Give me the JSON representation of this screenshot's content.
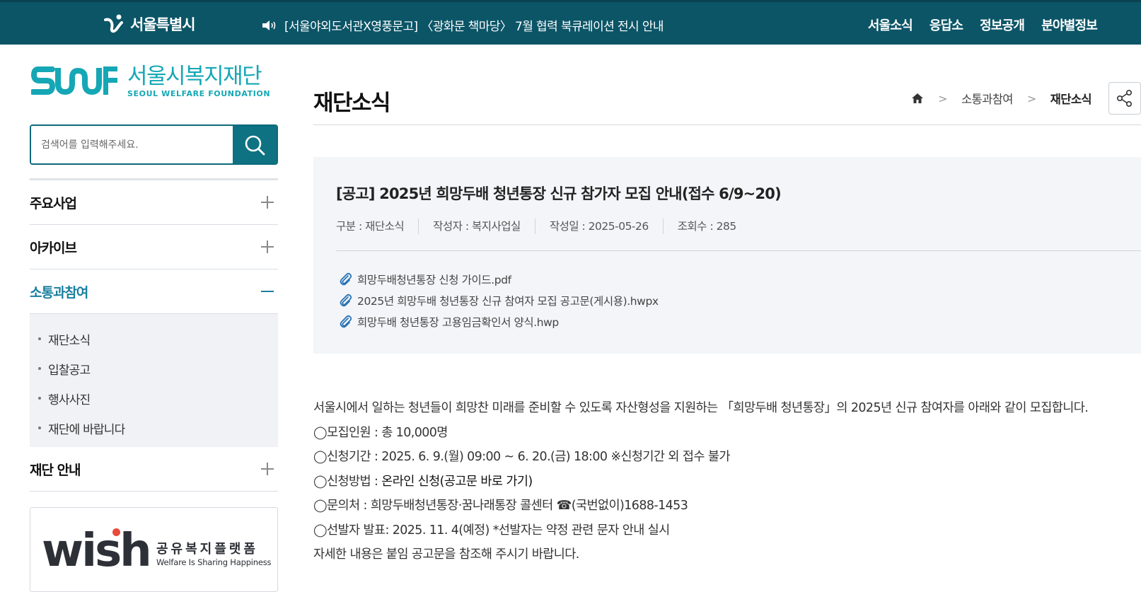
{
  "topbar": {
    "seoul_logo_text": "서울특별시",
    "notice_text": "[서울야외도서관X영풍문고] 〈광화문 책마당〉 7월 협력 북큐레이션 전시 안내",
    "nav": [
      "서울소식",
      "응답소",
      "정보공개",
      "분야별정보"
    ]
  },
  "brand": {
    "name_ko": "서울시복지재단",
    "name_en": "SEOUL WELFARE FOUNDATION"
  },
  "search": {
    "placeholder": "검색어를 입력해주세요."
  },
  "lnb": {
    "items": [
      {
        "label": "주요사업",
        "state": "collapsed"
      },
      {
        "label": "아카이브",
        "state": "collapsed"
      },
      {
        "label": "소통과참여",
        "state": "expanded"
      },
      {
        "label": "재단 안내",
        "state": "collapsed"
      }
    ],
    "subitems": [
      "재단소식",
      "입찰공고",
      "행사사진",
      "재단에 바랍니다"
    ]
  },
  "wish": {
    "word": "wish",
    "kr": "공유복지플랫폼",
    "en": "Welfare Is Sharing Happiness"
  },
  "page": {
    "title": "재단소식",
    "breadcrumb": [
      "소통과참여",
      "재단소식"
    ]
  },
  "post": {
    "title": "[공고] 2025년 희망두배 청년통장 신규 참가자 모집 안내(접수 6/9~20)",
    "meta": [
      "구분 : 재단소식",
      "작성자 : 복지사업실",
      "작성일 : 2025-05-26",
      "조회수 : 285"
    ],
    "files": [
      "희망두배청년통장 신청 가이드.pdf",
      "2025년 희망두배 청년통장 신규 참여자 모집 공고문(게시용).hwpx",
      "희망두배 청년통장 고용임금확인서 양식.hwp"
    ],
    "body": {
      "line1": "서울시에서 일하는 청년들이 희망찬 미래를 준비할 수 있도록 자산형성을 지원하는 「희망두배 청년통장」의 2025년 신규 참여자를 아래와 같이 모집합니다.",
      "line2": "◯모집인원 : 총 10,000명",
      "line3": "◯신청기간 : 2025. 6. 9.(월) 09:00 ~ 6. 20.(금) 18:00 ※신청기간 외 접수 불가",
      "line4_prefix": "◯신청방법 : ",
      "line4_link": "온라인 신청(공고문 바로 가기)",
      "line5": "◯문의처 : 희망두배청년통장·꿈나래통장 콜센터 ☎(국번없이)1688-1453",
      "line6": "◯선발자 발표: 2025. 11. 4(예정) *선발자는 약정 관련 문자 안내 실시",
      "line7": "자세한 내용은 붙임 공고문을 참조해 주시기 바랍니다."
    }
  },
  "colors": {
    "topbar": "#0b5567",
    "brand": "#15a7b5",
    "active_menu": "#1a7fa0",
    "search_button": "#0e7283"
  }
}
